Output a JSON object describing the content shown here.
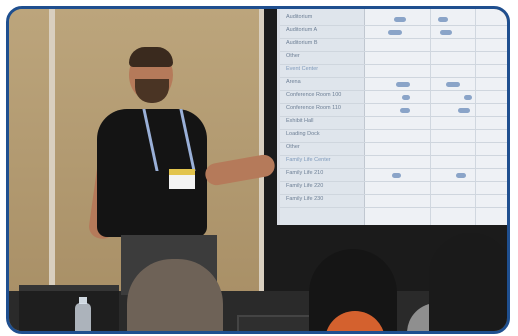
{
  "scene": {
    "description_colors": {
      "frame_border": "#1f4f8f",
      "wall": "#b39a72",
      "screen_bg": "#eef1f5",
      "shirt": "#141414"
    }
  },
  "projection": {
    "rows": [
      {
        "label": "Auditorium",
        "group": false,
        "blobs": [
          [
            114,
            12
          ],
          [
            158,
            10
          ]
        ]
      },
      {
        "label": "Auditorium A",
        "group": false,
        "blobs": [
          [
            108,
            14
          ],
          [
            160,
            12
          ]
        ]
      },
      {
        "label": "Auditorium B",
        "group": false,
        "blobs": []
      },
      {
        "label": "Other",
        "group": false,
        "blobs": []
      },
      {
        "label": "Event Center",
        "group": true,
        "blobs": []
      },
      {
        "label": "Arena",
        "group": false,
        "blobs": [
          [
            116,
            14
          ],
          [
            166,
            14
          ]
        ]
      },
      {
        "label": "Conference Room 100",
        "group": false,
        "blobs": [
          [
            122,
            8
          ],
          [
            184,
            8
          ]
        ]
      },
      {
        "label": "Conference Room 110",
        "group": false,
        "blobs": [
          [
            120,
            10
          ],
          [
            178,
            12
          ]
        ]
      },
      {
        "label": "Exhibit Hall",
        "group": false,
        "blobs": []
      },
      {
        "label": "Loading Dock",
        "group": false,
        "blobs": []
      },
      {
        "label": "Other",
        "group": false,
        "blobs": []
      },
      {
        "label": "Family Life Center",
        "group": true,
        "blobs": []
      },
      {
        "label": "Family Life 210",
        "group": false,
        "blobs": [
          [
            112,
            9
          ],
          [
            176,
            10
          ]
        ]
      },
      {
        "label": "Family Life 220",
        "group": false,
        "blobs": []
      },
      {
        "label": "Family Life 230",
        "group": false,
        "blobs": []
      }
    ]
  }
}
